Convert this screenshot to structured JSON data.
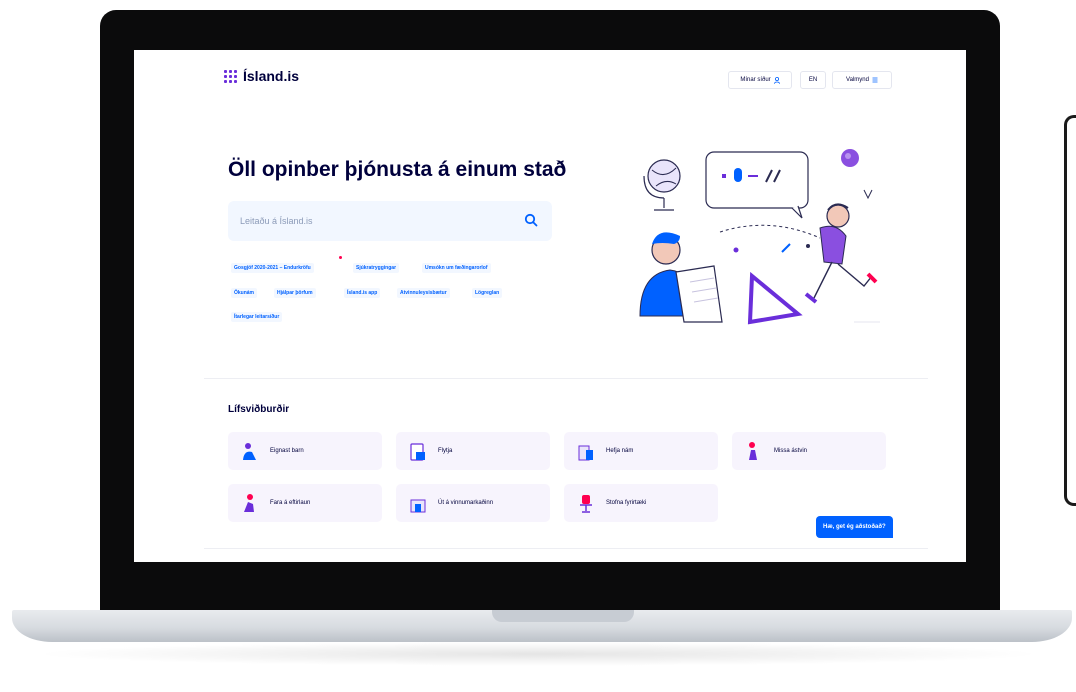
{
  "site": {
    "logo_text": "Ísland.is"
  },
  "header": {
    "my_pages_label": "Mínar síður",
    "language_label": "EN",
    "menu_label": "Valmynd"
  },
  "hero": {
    "title": "Öll opinber þjónusta á einum stað",
    "search_placeholder": "Leitaðu á Ísland.is",
    "tags": [
      "Gosgjöf 2020-2021 – Endurkröfu",
      "Sjúkratryggingar",
      "Umsókn um fæðingarorlof",
      "Ökunám",
      "Hjálpar þörfum",
      "Ísland.is app",
      "Atvinnuleysisbætur",
      "Lögreglan",
      "Ítarlegar leitarsíður"
    ]
  },
  "life_events": {
    "title": "Lífsviðburðir",
    "items": [
      {
        "label": "Eignast barn"
      },
      {
        "label": "Flytja"
      },
      {
        "label": "Hefja nám"
      },
      {
        "label": "Missa ástvin"
      },
      {
        "label": "Fara á eftirlaun"
      },
      {
        "label": "Út á vinnumarkaðinn"
      },
      {
        "label": "Stofna fyrirtæki"
      }
    ]
  },
  "chat": {
    "label": "Hæ, get ég aðstoðað?"
  },
  "colors": {
    "brand_purple": "#6a2eda",
    "brand_blue": "#0061ff",
    "dark_navy": "#00003c",
    "card_bg": "#f7f4fd",
    "search_bg": "#f2f7ff"
  }
}
